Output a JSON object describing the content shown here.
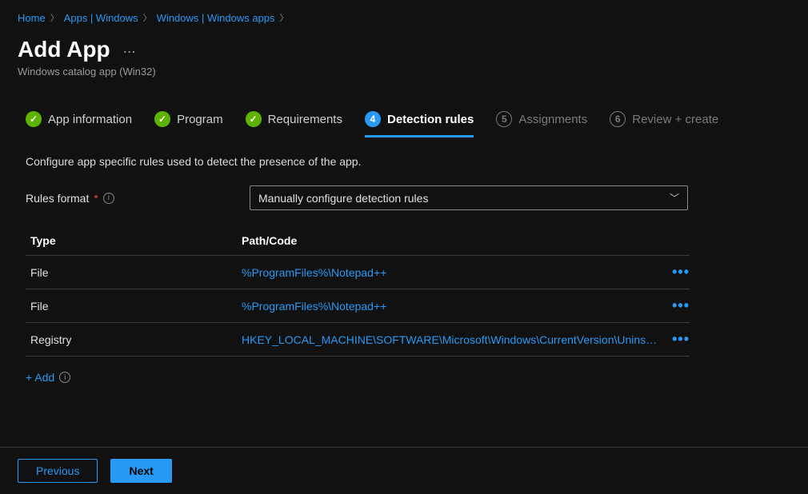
{
  "breadcrumb": [
    {
      "label": "Home"
    },
    {
      "label": "Apps | Windows"
    },
    {
      "label": "Windows | Windows apps"
    }
  ],
  "header": {
    "title": "Add App",
    "subtitle": "Windows catalog app (Win32)"
  },
  "tabs": [
    {
      "label": "App information",
      "state": "done"
    },
    {
      "label": "Program",
      "state": "done"
    },
    {
      "label": "Requirements",
      "state": "done"
    },
    {
      "label": "Detection rules",
      "num": "4",
      "state": "active"
    },
    {
      "label": "Assignments",
      "num": "5",
      "state": "pending"
    },
    {
      "label": "Review + create",
      "num": "6",
      "state": "pending"
    }
  ],
  "section": {
    "description": "Configure app specific rules used to detect the presence of the app.",
    "rules_format_label": "Rules format",
    "rules_format_value": "Manually configure detection rules"
  },
  "table": {
    "headers": {
      "type": "Type",
      "path": "Path/Code"
    },
    "rows": [
      {
        "type": "File",
        "path": "%ProgramFiles%\\Notepad++"
      },
      {
        "type": "File",
        "path": "%ProgramFiles%\\Notepad++"
      },
      {
        "type": "Registry",
        "path": "HKEY_LOCAL_MACHINE\\SOFTWARE\\Microsoft\\Windows\\CurrentVersion\\Unins…"
      }
    ]
  },
  "add_link": "+ Add",
  "footer": {
    "previous": "Previous",
    "next": "Next"
  }
}
